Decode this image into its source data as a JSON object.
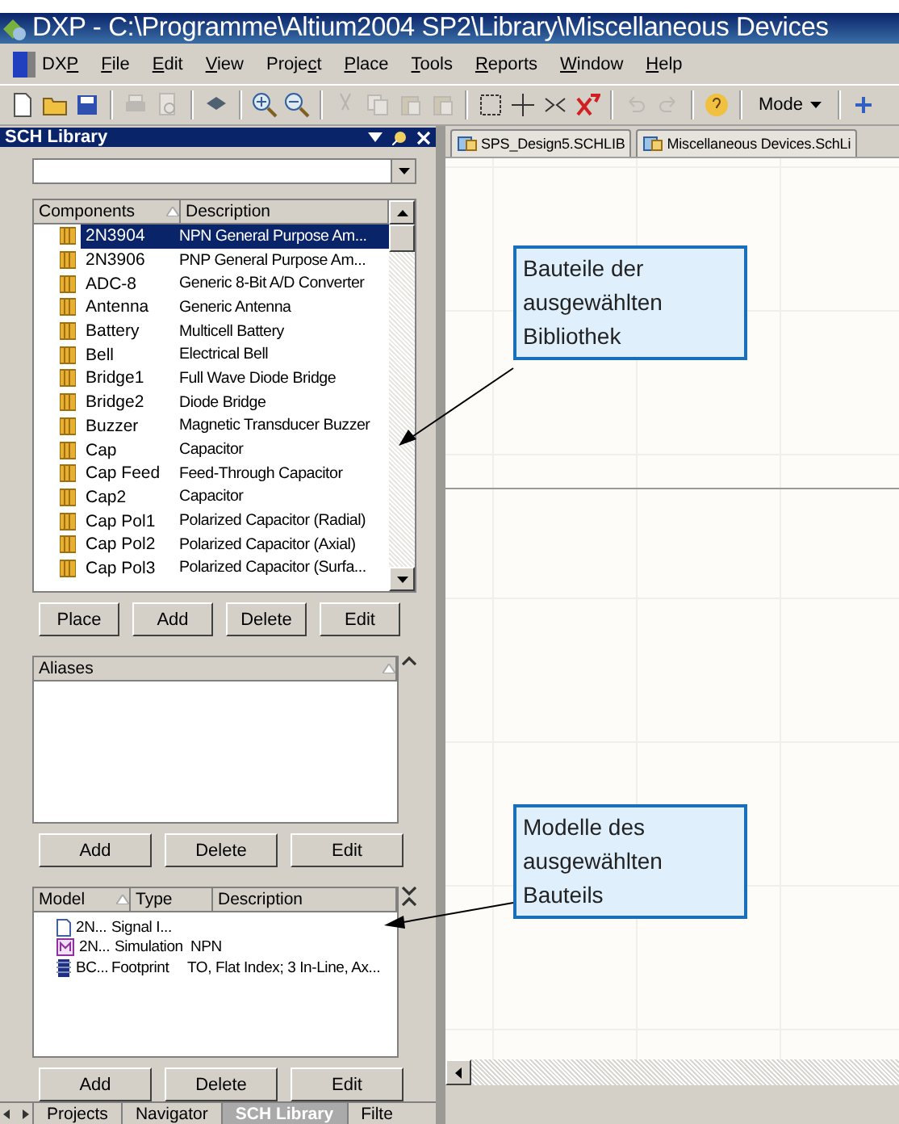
{
  "window": {
    "title": "DXP - C:\\Programme\\Altium2004 SP2\\Library\\Miscellaneous Devices"
  },
  "menu": [
    {
      "before": "DX",
      "key": "P"
    },
    {
      "key": "F",
      "after": "ile"
    },
    {
      "key": "E",
      "after": "dit"
    },
    {
      "key": "V",
      "after": "iew"
    },
    {
      "before": "Proje",
      "key": "c",
      "after": "t"
    },
    {
      "key": "P",
      "after": "lace"
    },
    {
      "key": "T",
      "after": "ools"
    },
    {
      "key": "R",
      "after": "eports"
    },
    {
      "key": "W",
      "after": "indow"
    },
    {
      "key": "H",
      "after": "elp"
    }
  ],
  "toolbar": {
    "mode": "Mode"
  },
  "panel": {
    "title": "SCH Library",
    "components": {
      "columns": [
        "Components",
        "Description"
      ],
      "rows": [
        {
          "name": "2N3904",
          "description": "NPN General Purpose Am...",
          "selected": true
        },
        {
          "name": "2N3906",
          "description": "PNP General Purpose Am...",
          "selected": false
        },
        {
          "name": "ADC-8",
          "description": "Generic 8-Bit A/D Converter",
          "selected": false
        },
        {
          "name": "Antenna",
          "description": "Generic Antenna",
          "selected": false
        },
        {
          "name": "Battery",
          "description": "Multicell Battery",
          "selected": false
        },
        {
          "name": "Bell",
          "description": "Electrical Bell",
          "selected": false
        },
        {
          "name": "Bridge1",
          "description": "Full Wave Diode Bridge",
          "selected": false
        },
        {
          "name": "Bridge2",
          "description": "Diode Bridge",
          "selected": false
        },
        {
          "name": "Buzzer",
          "description": "Magnetic Transducer Buzzer",
          "selected": false
        },
        {
          "name": "Cap",
          "description": "Capacitor",
          "selected": false
        },
        {
          "name": "Cap Feed",
          "description": "Feed-Through Capacitor",
          "selected": false
        },
        {
          "name": "Cap2",
          "description": "Capacitor",
          "selected": false
        },
        {
          "name": "Cap Pol1",
          "description": "Polarized Capacitor (Radial)",
          "selected": false
        },
        {
          "name": "Cap Pol2",
          "description": "Polarized Capacitor (Axial)",
          "selected": false
        },
        {
          "name": "Cap Pol3",
          "description": "Polarized Capacitor (Surfa...",
          "selected": false
        }
      ],
      "buttons": [
        "Place",
        "Add",
        "Delete",
        "Edit"
      ]
    },
    "aliases": {
      "columns": [
        "Aliases"
      ],
      "buttons": [
        "Add",
        "Delete",
        "Edit"
      ]
    },
    "models": {
      "columns": [
        "Model",
        "Type",
        "Description"
      ],
      "rows": [
        {
          "kind": "signal",
          "model": "2N...",
          "type": "Signal I...",
          "description": ""
        },
        {
          "kind": "simulation",
          "model": "2N...",
          "type": "Simulation",
          "description": "NPN"
        },
        {
          "kind": "footprint",
          "model": "BC...",
          "type": "Footprint",
          "description": "TO, Flat Index; 3 In-Line, Ax..."
        }
      ],
      "buttons": [
        "Add",
        "Delete",
        "Edit"
      ]
    },
    "tabs": [
      {
        "label": "Projects",
        "selected": false
      },
      {
        "label": "Navigator",
        "selected": false
      },
      {
        "label": "SCH Library",
        "selected": true
      },
      {
        "label": "Filte",
        "selected": false
      }
    ]
  },
  "documents": [
    {
      "label": "SPS_Design5.SCHLIB"
    },
    {
      "label": "Miscellaneous Devices.SchLi"
    }
  ],
  "callouts": [
    {
      "text": "Bauteile der ausgewählten Bibliothek"
    },
    {
      "text": "Modelle des ausgewählten Bauteils"
    }
  ]
}
